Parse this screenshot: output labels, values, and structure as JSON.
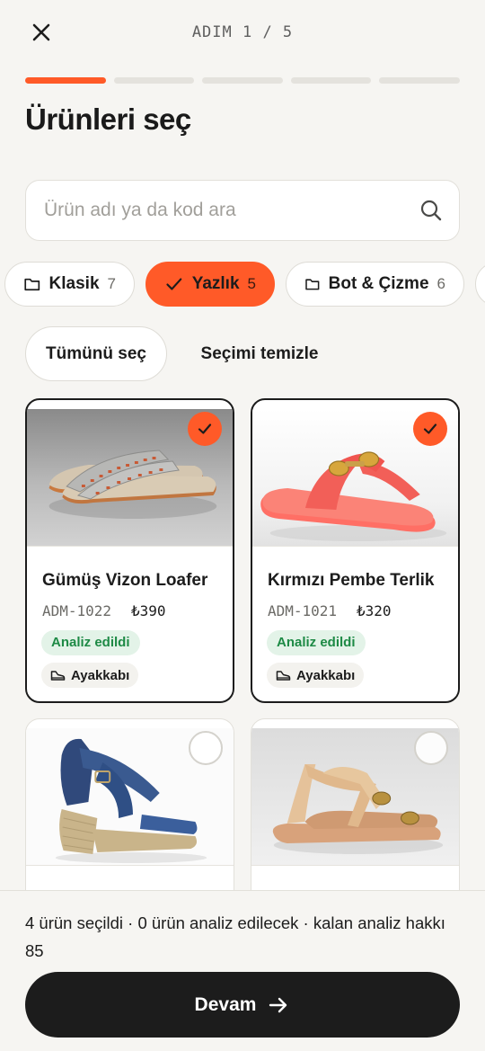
{
  "header": {
    "close_icon": "close-icon",
    "step_label": "ADIM 1 / 5"
  },
  "progress": {
    "current_step": 1,
    "total_steps": 5
  },
  "page": {
    "title": "Ürünleri seç"
  },
  "search": {
    "placeholder": "Ürün adı ya da kod ara",
    "value": "",
    "icon": "search-icon"
  },
  "categories": [
    {
      "label": "Klasik",
      "count": "7",
      "icon": "folder-icon",
      "active": false
    },
    {
      "label": "Yazlık",
      "count": "5",
      "icon": "check-icon",
      "active": true
    },
    {
      "label": "Bot & Çizme",
      "count": "6",
      "icon": "folder-icon",
      "active": false
    }
  ],
  "actions": {
    "select_all": "Tümünü seç",
    "clear_selection": "Seçimi temizle"
  },
  "products": [
    {
      "name": "Gümüş Vizon Loafer",
      "code": "ADM-1022",
      "price": "₺390",
      "status": "Analiz edildi",
      "type": "Ayakkabı",
      "selected": true
    },
    {
      "name": "Kırmızı Pembe Terlik",
      "code": "ADM-1021",
      "price": "₺320",
      "status": "Analiz edildi",
      "type": "Ayakkabı",
      "selected": true
    },
    {
      "selected": false
    },
    {
      "selected": false
    }
  ],
  "footer": {
    "summary": "4 ürün seçildi · 0 ürün analiz edilecek · kalan analiz hakkı 85",
    "continue_label": "Devam"
  },
  "colors": {
    "accent": "#ff5a28",
    "dark": "#1c1c1c",
    "background": "#f6f5f2",
    "success": "#1d8a45"
  }
}
